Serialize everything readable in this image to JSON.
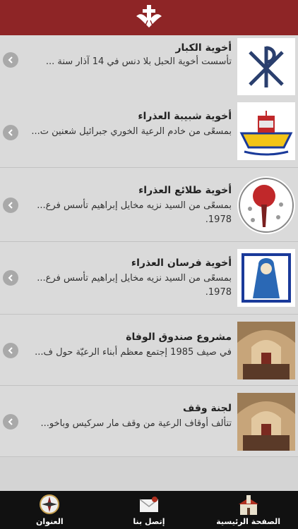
{
  "header": {
    "logo_icon": "dove-cross-logo-icon"
  },
  "items": [
    {
      "title": "أخوية الكبار",
      "desc": "تأسست أخوية الحبل بلا دنس في 14 آذار سنة ...",
      "thumb_icon": "chi-rho-emblem-icon"
    },
    {
      "title": "أخوية شبيبة العذراء",
      "desc": "بمسعًى من خادم الرعية الخوري جبرائيل شعنين ت...",
      "thumb_icon": "lebanon-boat-emblem-icon"
    },
    {
      "title": "أخوية طلائع العذراء",
      "desc": "بمسعًى من السيد نزيه مخايل إبراهيم تأسس فرع... 1978.",
      "thumb_icon": "torch-emblem-icon"
    },
    {
      "title": "أخوية فرسان العذراء",
      "desc": "بمسعًى من السيد نزيه مخايل إبراهيم تأسس فرع... 1978.",
      "thumb_icon": "madonna-emblem-icon"
    },
    {
      "title": "مشروع صندوق الوفاة",
      "desc": "في صيف 1985 إجتمع معظم أبناء الرعيّة حول ف...",
      "thumb_icon": "church-interior-photo-icon"
    },
    {
      "title": "لجنة وقف",
      "desc": "تتألف أوقاف الرعية من وقف مار سركيس وباخو...",
      "thumb_icon": "church-interior-photo-icon"
    }
  ],
  "tabs": [
    {
      "label": "الصفحة الرئيسية",
      "icon": "church-home-icon"
    },
    {
      "label": "إتصل بنا",
      "icon": "envelope-contact-icon"
    },
    {
      "label": "العنوان",
      "icon": "compass-address-icon"
    }
  ],
  "colors": {
    "header_bg": "#8e2526",
    "row_bg": "#dadada",
    "tabbar_bg": "#111111",
    "chevron_bg": "#a9a9a9"
  }
}
